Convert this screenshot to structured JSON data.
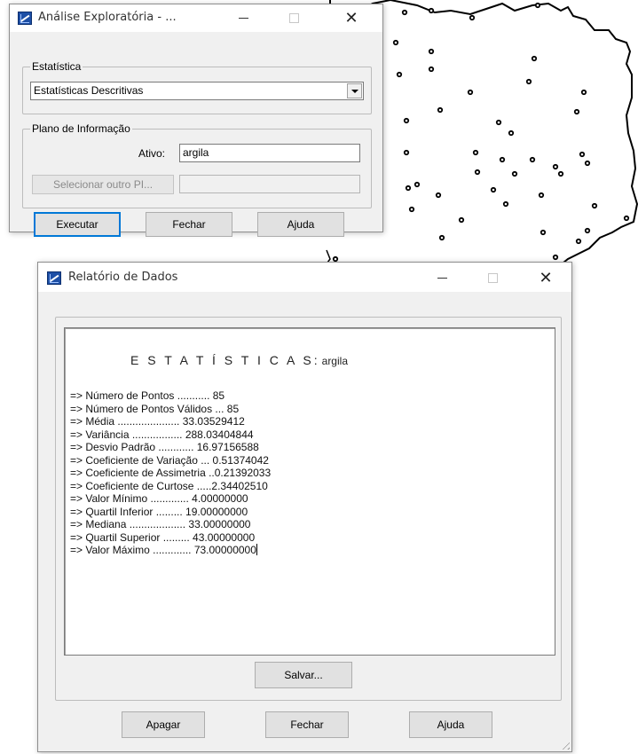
{
  "analise_window": {
    "title": "Análise Exploratória - ...",
    "statistics_group": {
      "label": "Estatística",
      "selected": "Estatísticas Descritivas"
    },
    "plano_group": {
      "label": "Plano de Informação",
      "ativo_label": "Ativo:",
      "ativo_value": "argila",
      "select_other_label": "Selecionar outro PI...",
      "select_other_value": ""
    },
    "buttons": {
      "executar": "Executar",
      "fechar": "Fechar",
      "ajuda": "Ajuda"
    }
  },
  "report_window": {
    "title": "Relatório de Dados",
    "heading": "E S T A T Í S T I C A S:",
    "variable": "argila",
    "lines": [
      "=> Número de Pontos ........... 85",
      "=> Número de Pontos Válidos ... 85",
      "=> Média ..................... 33.03529412",
      "=> Variância ................. 288.03404844",
      "=> Desvio Padrão ............ 16.97156588",
      "=> Coeficiente de Variação ... 0.51374042",
      "=> Coeficiente de Assimetria ..0.21392033",
      "=> Coeficiente de Curtose .....2.34402510",
      "=> Valor Mínimo ............. 4.00000000",
      "=> Quartil Inferior ......... 19.00000000",
      "=> Mediana ................... 33.00000000",
      "=> Quartil Superior ......... 43.00000000",
      "=> Valor Máximo ............. 73.00000000"
    ],
    "buttons": {
      "salvar": "Salvar...",
      "apagar": "Apagar",
      "fechar": "Fechar",
      "ajuda": "Ajuda"
    }
  },
  "window_controls": {
    "minimize": "—",
    "close": "✕"
  },
  "map": {
    "point_color": "#000000",
    "boundary_color": "#000000"
  }
}
